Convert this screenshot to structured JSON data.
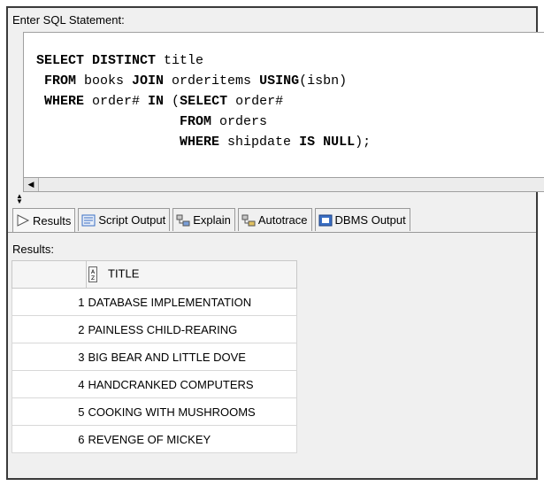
{
  "sql_panel": {
    "label": "Enter SQL Statement:",
    "lines": [
      [
        {
          "t": "SELECT DISTINCT",
          "k": 1
        },
        {
          "t": " title",
          "k": 0
        }
      ],
      [
        {
          "t": " FROM",
          "k": 1
        },
        {
          "t": " books ",
          "k": 0
        },
        {
          "t": "JOIN",
          "k": 1
        },
        {
          "t": " orderitems ",
          "k": 0
        },
        {
          "t": "USING",
          "k": 1
        },
        {
          "t": "(isbn)",
          "k": 0
        }
      ],
      [
        {
          "t": " WHERE",
          "k": 1
        },
        {
          "t": " order# ",
          "k": 0
        },
        {
          "t": "IN",
          "k": 1
        },
        {
          "t": " (",
          "k": 0
        },
        {
          "t": "SELECT",
          "k": 1
        },
        {
          "t": " order#",
          "k": 0
        }
      ],
      [
        {
          "t": "                  ",
          "k": 0
        },
        {
          "t": "FROM",
          "k": 1
        },
        {
          "t": " orders",
          "k": 0
        }
      ],
      [
        {
          "t": "                  ",
          "k": 0
        },
        {
          "t": "WHERE",
          "k": 1
        },
        {
          "t": " shipdate ",
          "k": 0
        },
        {
          "t": "IS NULL",
          "k": 1
        },
        {
          "t": ");",
          "k": 0
        }
      ]
    ]
  },
  "tabs": [
    {
      "label": "Results",
      "icon": "play-arrow-icon"
    },
    {
      "label": "Script Output",
      "icon": "script-output-icon"
    },
    {
      "label": "Explain",
      "icon": "explain-plan-icon"
    },
    {
      "label": "Autotrace",
      "icon": "autotrace-icon"
    },
    {
      "label": "DBMS Output",
      "icon": "dbms-output-icon"
    }
  ],
  "results": {
    "label": "Results:",
    "column_header": "TITLE",
    "rows": [
      {
        "num": "1",
        "title": "DATABASE IMPLEMENTATION"
      },
      {
        "num": "2",
        "title": "PAINLESS CHILD-REARING"
      },
      {
        "num": "3",
        "title": "BIG BEAR AND LITTLE DOVE"
      },
      {
        "num": "4",
        "title": "HANDCRANKED COMPUTERS"
      },
      {
        "num": "5",
        "title": "COOKING WITH MUSHROOMS"
      },
      {
        "num": "6",
        "title": "REVENGE OF MICKEY"
      }
    ]
  },
  "colors": {
    "frame_border": "#3a3a3a",
    "panel_bg": "#f0f0f0",
    "editor_bg": "#ffffff",
    "icon_blue": "#3a6fc4"
  }
}
